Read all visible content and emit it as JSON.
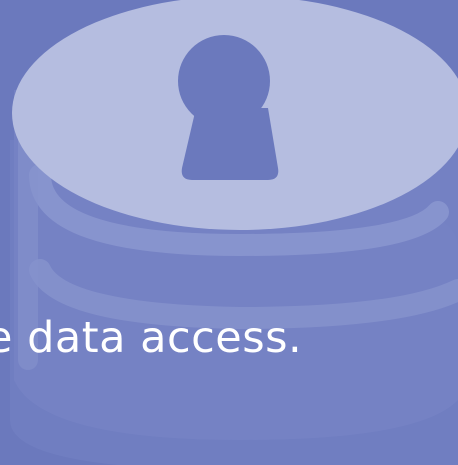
{
  "colors": {
    "background": "#6b79bd",
    "cylinder_top": "#b5bde0",
    "cylinder_side": "#7a87c6",
    "keyhole": "#6b79bd",
    "stripe": "#8a96cf",
    "text": "#ffffff"
  },
  "illustration": {
    "icon": "database-lock-icon"
  },
  "hero": {
    "tagline": "e data access."
  }
}
